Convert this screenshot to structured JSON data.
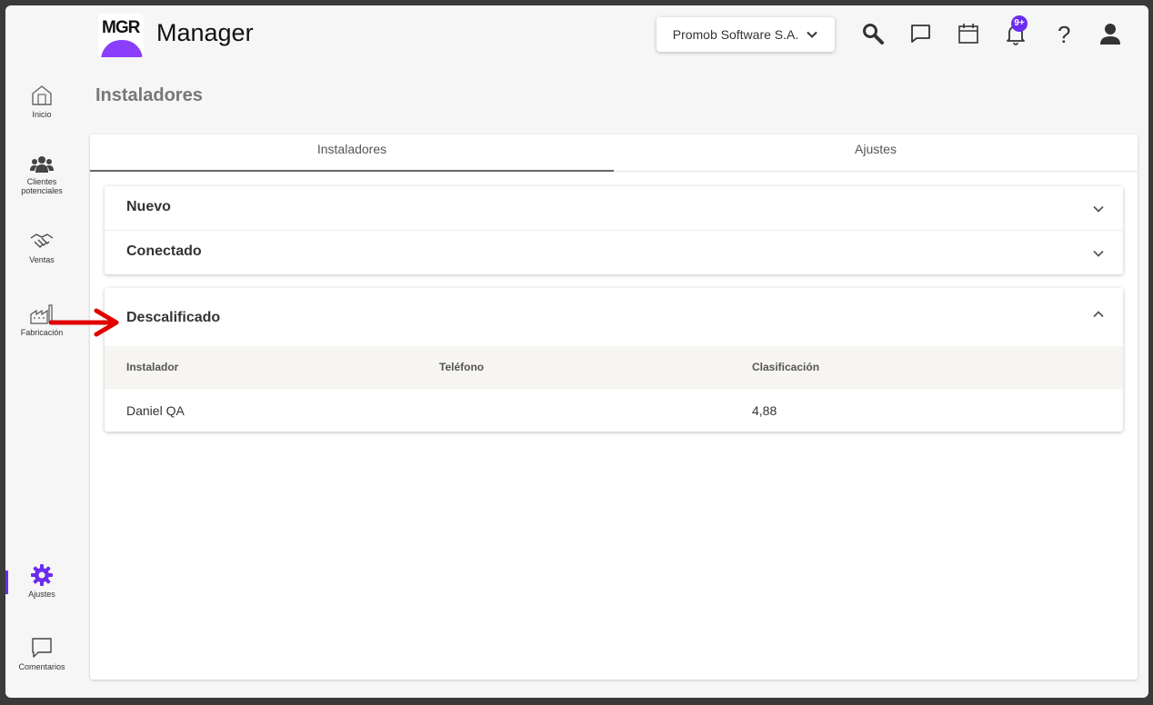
{
  "header": {
    "logo_text": "MGR",
    "app_name": "Manager",
    "company": "Promob Software S.A.",
    "notification_badge": "9+",
    "icons": [
      "search-icon",
      "chat-icon",
      "calendar-icon",
      "bell-icon",
      "help-icon",
      "user-icon"
    ]
  },
  "sidebar": {
    "items": [
      {
        "label": "Inicio",
        "icon": "home-icon"
      },
      {
        "label": "Clientes potenciales",
        "icon": "people-icon"
      },
      {
        "label": "Ventas",
        "icon": "handshake-icon"
      },
      {
        "label": "Fabricación",
        "icon": "factory-icon"
      },
      {
        "label": "Ajustes",
        "icon": "gear-icon",
        "active": true
      },
      {
        "label": "Comentarios",
        "icon": "comment-icon"
      }
    ]
  },
  "page": {
    "title": "Instaladores",
    "tabs": [
      {
        "label": "Instaladores",
        "active": true
      },
      {
        "label": "Ajustes",
        "active": false
      }
    ],
    "sections": [
      {
        "title": "Nuevo",
        "expanded": false
      },
      {
        "title": "Conectado",
        "expanded": false
      },
      {
        "title": "Descalificado",
        "expanded": true
      }
    ],
    "table": {
      "columns": [
        "Instalador",
        "Teléfono",
        "Clasificación"
      ],
      "rows": [
        {
          "instalador": "Daniel QA",
          "telefono": "",
          "clasificacion": "4,88"
        }
      ]
    }
  },
  "colors": {
    "accent": "#6a2cf0",
    "logo_purple": "#8a3ffc",
    "annotation_arrow": "#e00000"
  }
}
